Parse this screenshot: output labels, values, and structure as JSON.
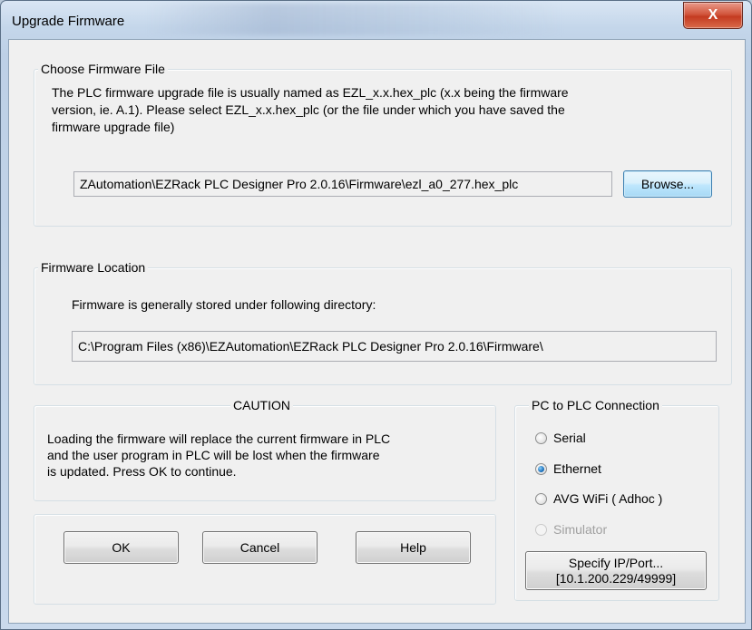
{
  "window": {
    "title": "Upgrade Firmware",
    "close_glyph": "X"
  },
  "choose_file": {
    "label": "Choose Firmware File",
    "description_line1": "The PLC firmware upgrade file is usually named as EZL_x.x.hex_plc (x.x being the firmware",
    "description_line2": "version, ie. A.1).  Please select EZL_x.x.hex_plc (or the file under which you have saved the",
    "description_line3": "firmware upgrade file)",
    "path_value": "ZAutomation\\EZRack PLC Designer Pro 2.0.16\\Firmware\\ezl_a0_277.hex_plc",
    "browse_label": "Browse..."
  },
  "location": {
    "label": "Firmware Location",
    "description": "Firmware is generally stored under following directory:",
    "path_value": "C:\\Program Files (x86)\\EZAutomation\\EZRack PLC Designer Pro 2.0.16\\Firmware\\"
  },
  "caution": {
    "label": "CAUTION",
    "line1": "Loading the firmware will replace the current firmware in PLC",
    "line2": "and  the user program in  PLC will be lost when the firmware",
    "line3": "is updated.  Press OK to continue."
  },
  "buttons": {
    "ok": "OK",
    "cancel": "Cancel",
    "help": "Help"
  },
  "connection": {
    "label": "PC to PLC Connection",
    "options": [
      {
        "label": "Serial",
        "selected": false,
        "enabled": true
      },
      {
        "label": "Ethernet",
        "selected": true,
        "enabled": true
      },
      {
        "label": "AVG WiFi ( Adhoc )",
        "selected": false,
        "enabled": true
      },
      {
        "label": "Simulator",
        "selected": false,
        "enabled": false
      }
    ],
    "specify_line1": "Specify IP/Port...",
    "specify_line2": "[10.1.200.229/49999]"
  }
}
